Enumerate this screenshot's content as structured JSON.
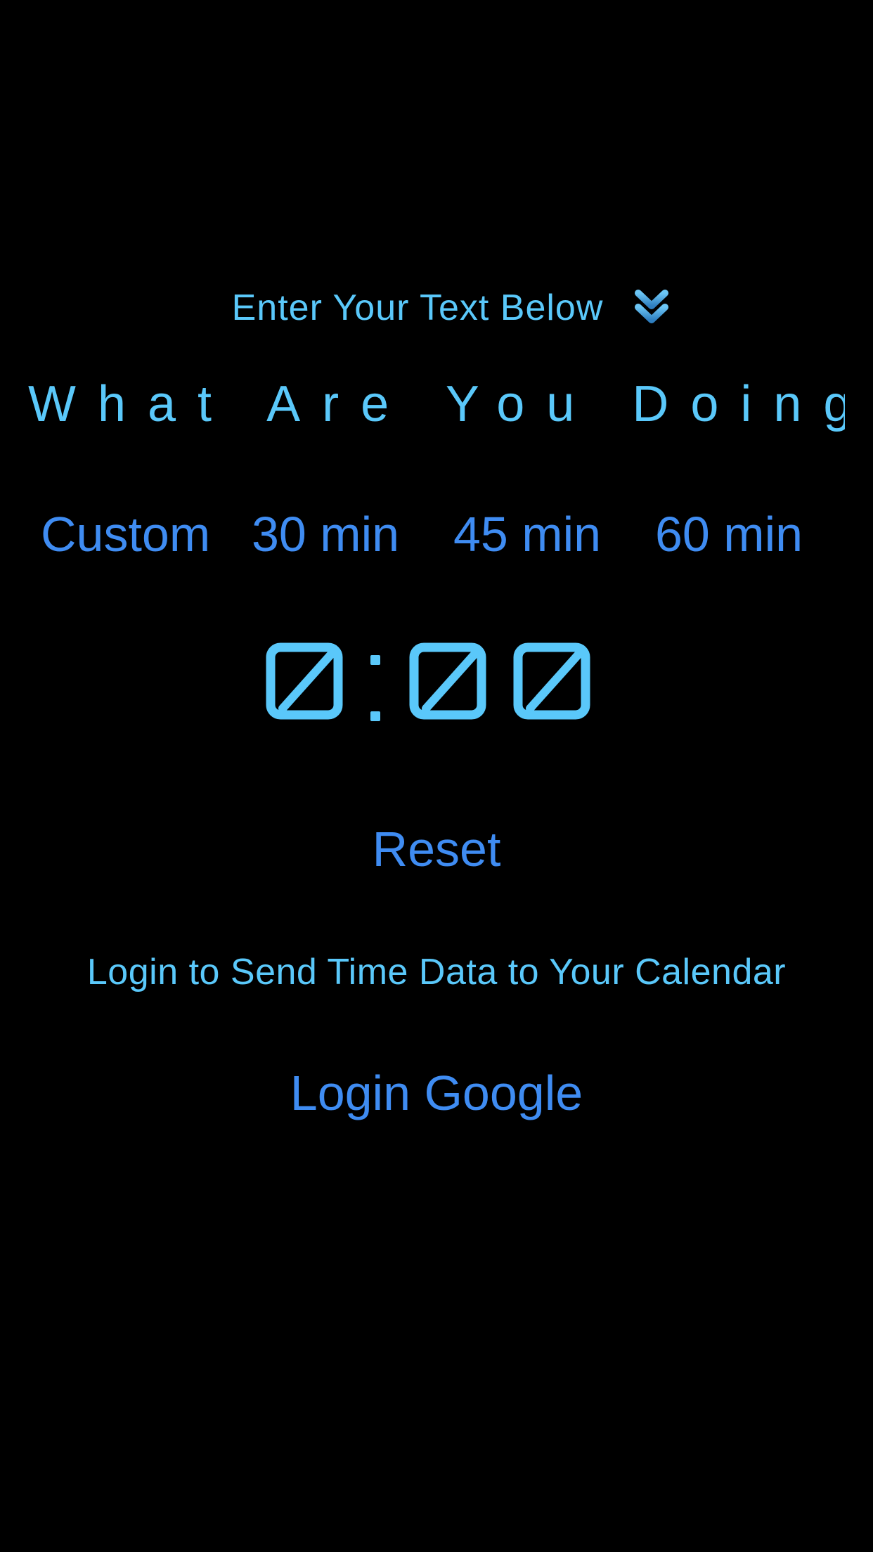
{
  "header": {
    "hint_text": "Enter Your Text Below",
    "hint_icon": "double-chevron-down-icon"
  },
  "task_input": {
    "placeholder": "What Are You Doing?",
    "value": ""
  },
  "durations": {
    "custom_label": "Custom",
    "thirty_label": "30 min",
    "fortyfive_label": "45 min",
    "sixty_label": "60 min"
  },
  "timer": {
    "display": "0:00",
    "minutes": "0",
    "seconds_tens": "0",
    "seconds_ones": "0"
  },
  "controls": {
    "reset_label": "Reset"
  },
  "login": {
    "caption": "Login to Send Time Data to Your Calendar",
    "button_label": "Login Google"
  },
  "colors": {
    "background": "#000000",
    "text_cyan": "#5ac8fa",
    "button_blue": "#3f8cf2"
  }
}
